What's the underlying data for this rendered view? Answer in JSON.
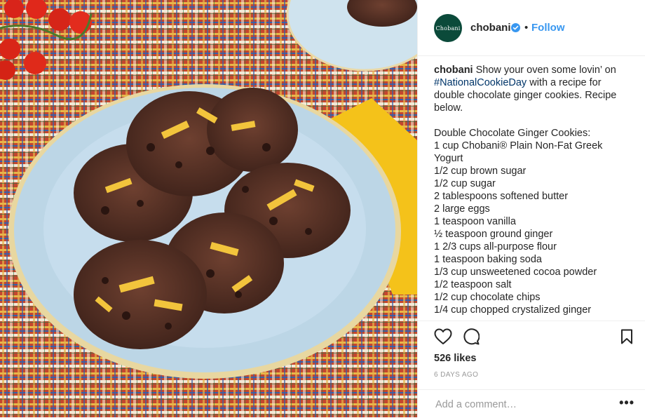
{
  "header": {
    "avatar_text": "Chobani",
    "username": "chobani",
    "separator": "•",
    "follow_label": "Follow",
    "verified_color": "#3897f0"
  },
  "caption": {
    "username": "chobani",
    "intro_a": " Show your oven some lovin’ on ",
    "hashtag": "#NationalCookieDay",
    "intro_b": " with a recipe for double chocolate ginger cookies. Recipe below.",
    "recipe_title": "Double Chocolate Ginger Cookies:",
    "ingredients": [
      "1 cup Chobani® Plain Non-Fat Greek Yogurt",
      "1/2 cup brown sugar",
      "1/2 cup sugar",
      "2 tablespoons softened butter",
      "2 large eggs",
      "1 teaspoon vanilla",
      "½ teaspoon ground ginger",
      "1 2/3 cups all-purpose flour",
      "1 teaspoon baking soda",
      "1/3 cup unsweetened cocoa powder",
      "1/2 teaspoon salt",
      "1/2 cup chocolate chips",
      "1/4 cup chopped crystalized ginger"
    ]
  },
  "actions": {
    "icons": [
      "heart-icon",
      "comment-icon",
      "bookmark-icon"
    ],
    "likes": "526 likes",
    "time_ago": "6 DAYS AGO"
  },
  "comment": {
    "placeholder": "Add a comment…",
    "more": "•••"
  },
  "colors": {
    "link": "#3897f0",
    "hashtag": "#003569",
    "muted": "#999999",
    "brand_green": "#0b4a3a"
  }
}
